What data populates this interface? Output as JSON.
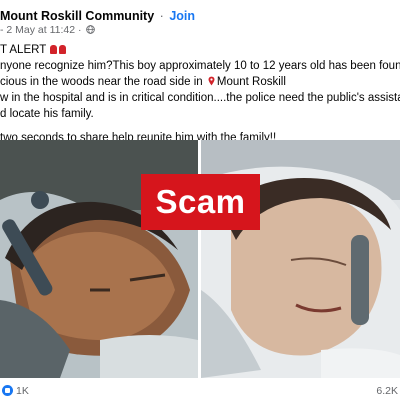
{
  "post": {
    "group_name": "Mount Roskill Community",
    "separator": "·",
    "join_label": "Join",
    "author_prefix": "-",
    "timestamp": "2 May at 11:42",
    "meta_separator": "·",
    "lines": [
      "T ALERT",
      "nyone recognize him?This boy approximately  10 to 12  years old has been found lying",
      "cious in the woods near the road side in ",
      "Mount Roskill",
      "w in the hospital and is in critical condition....the police need the public's assistance to i",
      "d locate his family.",
      "two seconds to share help reunite him with the family!!"
    ]
  },
  "overlay": {
    "badge_text": "Scam",
    "badge_color": "#d6151c"
  },
  "footer": {
    "like_count": "1K",
    "share_count": "6.2K"
  },
  "icons": {
    "globe": "globe-icon",
    "siren": "siren-icon",
    "pin": "map-pin-icon",
    "like": "like-reaction-icon"
  }
}
